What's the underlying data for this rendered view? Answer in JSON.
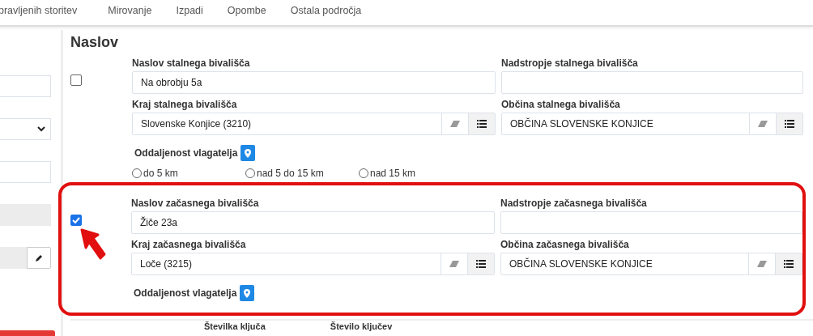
{
  "tabs": [
    {
      "label": "pravljenih storitev",
      "selected": false
    },
    {
      "label": "Mirovanje",
      "selected": false
    },
    {
      "label": "Izpadi",
      "selected": false
    },
    {
      "label": "Opombe",
      "selected": false
    },
    {
      "label": "Ostala področja",
      "selected": false
    }
  ],
  "left_panel": {
    "controls": [
      {
        "kind": "input"
      },
      {
        "kind": "select"
      },
      {
        "kind": "input"
      },
      {
        "kind": "readonly"
      },
      {
        "kind": "readonly-edit"
      },
      {
        "kind": "danger-button"
      }
    ]
  },
  "section": {
    "title": "Naslov",
    "groups": [
      {
        "checked": false,
        "highlighted": false,
        "fields": [
          {
            "label": "Naslov stalnega bivališča",
            "value": "Na obrobju 5a",
            "kind": "text"
          },
          {
            "label": "Nadstropje stalnega bivališča",
            "kind": "text"
          },
          {
            "label": "Kraj stalnega bivališča",
            "value": "Slovenske Konjice (3210)",
            "kind": "lookup"
          },
          {
            "label": "Občina stalnega bivališča",
            "value": "OBČINA SLOVENSKE KONJICE",
            "kind": "lookup"
          }
        ],
        "distance": {
          "label": "Oddaljenost vlagatelja",
          "options": [
            {
              "label": "do 5 km",
              "selected": false
            },
            {
              "label": "nad 5 do 15 km",
              "selected": false
            },
            {
              "label": "nad 15 km",
              "selected": false
            }
          ]
        }
      },
      {
        "checked": true,
        "highlighted": true,
        "fields": [
          {
            "label": "Naslov začasnega bivališča",
            "value": "Žiče 23a",
            "kind": "text"
          },
          {
            "label": "Nadstropje začasnega bivališča",
            "kind": "text"
          },
          {
            "label": "Kraj začasnega bivališča",
            "value": "Loče (3215)",
            "kind": "lookup"
          },
          {
            "label": "Občina začasnega bivališča",
            "value": "OBČINA SLOVENSKE KONJICE",
            "kind": "lookup"
          }
        ],
        "distance": {
          "label": "Oddaljenost vlagatelja"
        }
      }
    ]
  },
  "footer": {
    "columns": [
      "Številka ključa",
      "Število ključev"
    ]
  }
}
